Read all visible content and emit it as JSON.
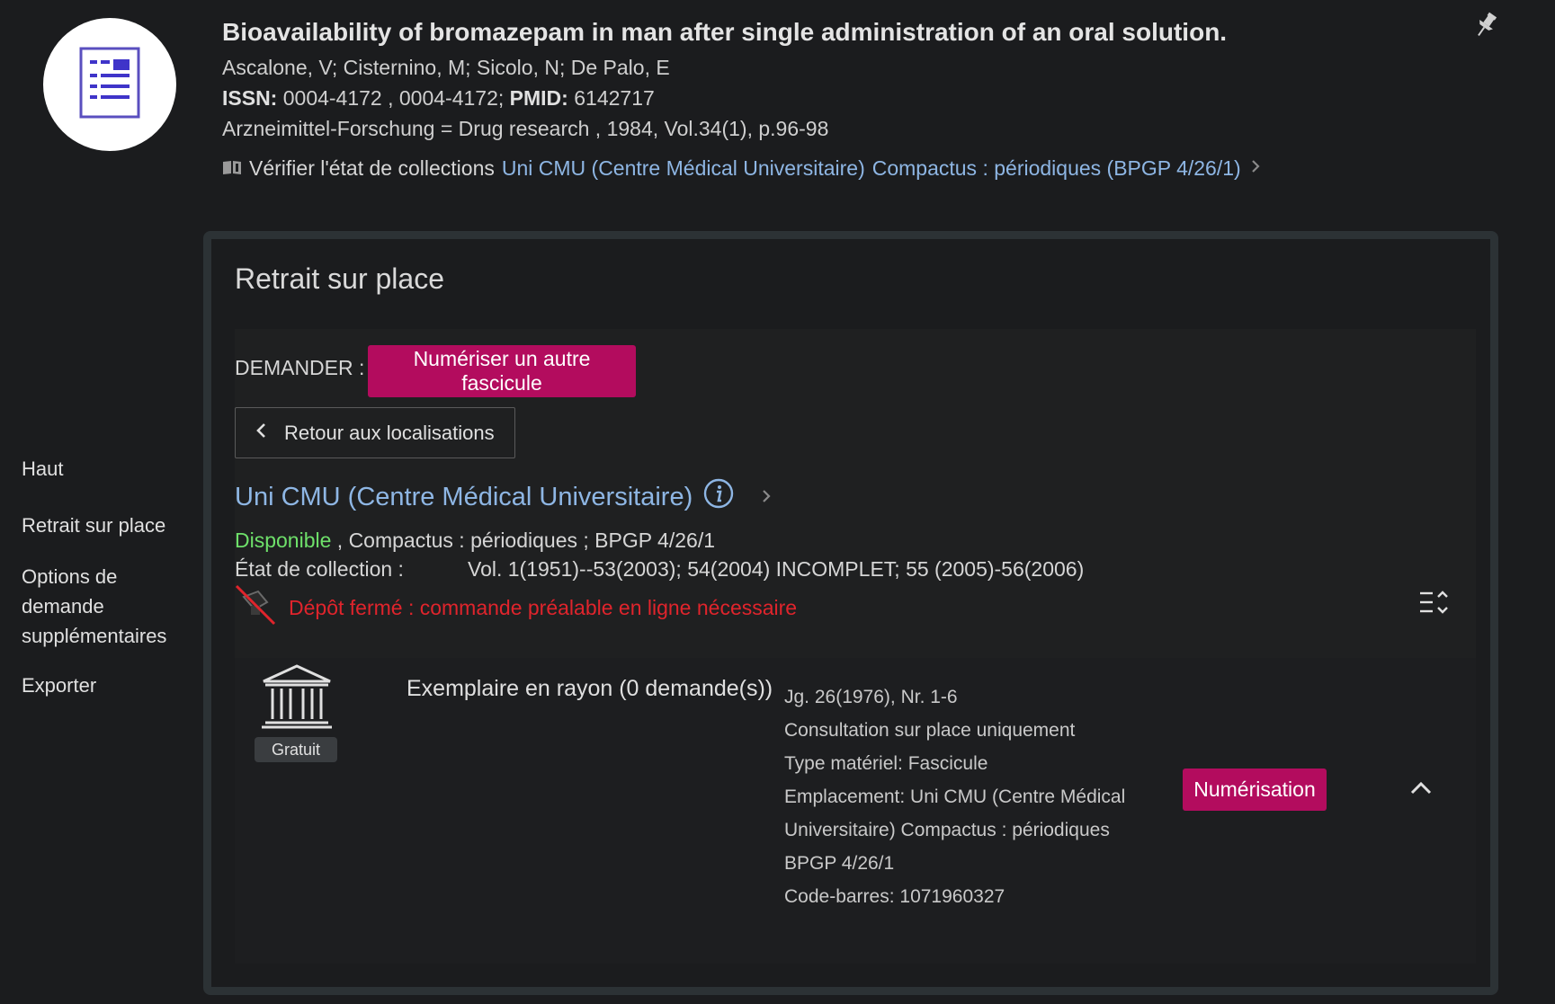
{
  "record": {
    "title": "Bioavailability of bromazepam in man after single administration of an oral solution.",
    "authors": "Ascalone, V; Cisternino, M; Sicolo, N; De Palo, E",
    "issn_label": "ISSN:",
    "issn_value": " 0004-4172 , 0004-4172;",
    "pmid_label": " PMID:",
    "pmid_value": " 6142717",
    "source": "Arzneimittel-Forschung = Drug research , 1984, Vol.34(1), p.96-98",
    "holdings_prefix": "Vérifier l'état de collections",
    "holdings_library": "Uni CMU (Centre Médical Universitaire)",
    "holdings_location": "Compactus : périodiques (BPGP 4/26/1)"
  },
  "sidenav": {
    "haut": "Haut",
    "retrait": "Retrait sur place",
    "options": "Options de demande supplémentaires",
    "exporter": "Exporter"
  },
  "panel": {
    "title": "Retrait sur place",
    "demander_label": "DEMANDER :",
    "numeriser_button": "Numériser un autre fascicule",
    "back_button": "Retour aux localisations",
    "location_title": "Uni CMU (Centre Médical Universitaire)",
    "availability": "Disponible",
    "availability_rest": " , Compactus : périodiques ; BPGP 4/26/1",
    "etat_label": "État de collection :",
    "etat_value": "Vol. 1(1951)--53(2003); 54(2004) INCOMPLET; 55 (2005)-56(2006)",
    "depot_text": "Dépôt fermé : commande préalable en ligne nécessaire"
  },
  "item": {
    "badge": "Gratuit",
    "title": "Exemplaire en rayon (0 demande(s))",
    "details": [
      "Jg. 26(1976), Nr. 1-6",
      "Consultation sur place uniquement",
      "Type matériel: Fascicule",
      "Emplacement: Uni CMU (Centre Médical Universitaire) Compactus : périodiques BPGP 4/26/1",
      "Code-barres: 1071960327"
    ],
    "numerisation_button": "Numérisation"
  },
  "colors": {
    "background": "#1b1c1e",
    "link": "#8eb6e4",
    "primary": "#b30c5e",
    "available": "#6ee06a",
    "warning": "#e0242c"
  },
  "icons": [
    "document-icon",
    "pin-icon",
    "book-icon",
    "chevron-right-icon",
    "chevron-left-icon",
    "info-icon",
    "no-print-icon",
    "expand-all-icon",
    "library-icon",
    "chevron-up-icon"
  ]
}
